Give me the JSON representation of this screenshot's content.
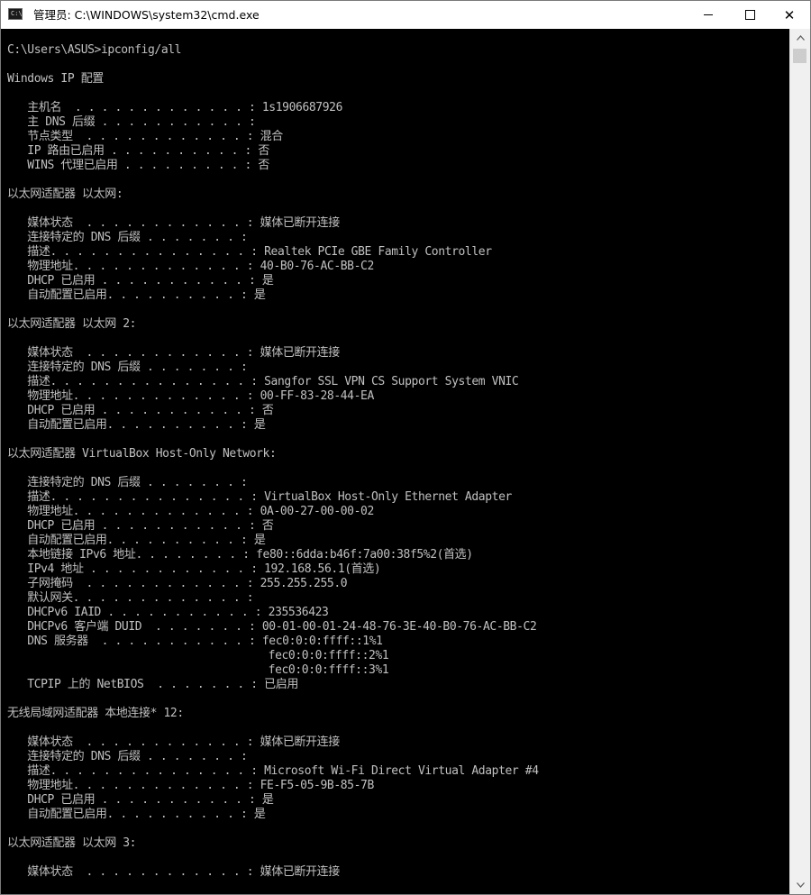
{
  "window": {
    "title": "管理员: C:\\WINDOWS\\system32\\cmd.exe",
    "icon": "cmd-icon",
    "icon_glyph": "C:\\"
  },
  "controls": {
    "minimize": "minimize-icon",
    "maximize": "maximize-icon",
    "close": "close-icon",
    "close_glyph": "✕"
  },
  "console": {
    "lines": [
      "C:\\Users\\ASUS>ipconfig/all",
      "",
      "Windows IP 配置",
      "",
      "   主机名  . . . . . . . . . . . . . : 1s1906687926",
      "   主 DNS 后缀 . . . . . . . . . . . :",
      "   节点类型  . . . . . . . . . . . . : 混合",
      "   IP 路由已启用 . . . . . . . . . . : 否",
      "   WINS 代理已启用 . . . . . . . . . : 否",
      "",
      "以太网适配器 以太网:",
      "",
      "   媒体状态  . . . . . . . . . . . . : 媒体已断开连接",
      "   连接特定的 DNS 后缀 . . . . . . . :",
      "   描述. . . . . . . . . . . . . . . : Realtek PCIe GBE Family Controller",
      "   物理地址. . . . . . . . . . . . . : 40-B0-76-AC-BB-C2",
      "   DHCP 已启用 . . . . . . . . . . . : 是",
      "   自动配置已启用. . . . . . . . . . : 是",
      "",
      "以太网适配器 以太网 2:",
      "",
      "   媒体状态  . . . . . . . . . . . . : 媒体已断开连接",
      "   连接特定的 DNS 后缀 . . . . . . . :",
      "   描述. . . . . . . . . . . . . . . : Sangfor SSL VPN CS Support System VNIC",
      "   物理地址. . . . . . . . . . . . . : 00-FF-83-28-44-EA",
      "   DHCP 已启用 . . . . . . . . . . . : 否",
      "   自动配置已启用. . . . . . . . . . : 是",
      "",
      "以太网适配器 VirtualBox Host-Only Network:",
      "",
      "   连接特定的 DNS 后缀 . . . . . . . :",
      "   描述. . . . . . . . . . . . . . . : VirtualBox Host-Only Ethernet Adapter",
      "   物理地址. . . . . . . . . . . . . : 0A-00-27-00-00-02",
      "   DHCP 已启用 . . . . . . . . . . . : 否",
      "   自动配置已启用. . . . . . . . . . : 是",
      "   本地链接 IPv6 地址. . . . . . . . : fe80::6dda:b46f:7a00:38f5%2(首选)",
      "   IPv4 地址 . . . . . . . . . . . . : 192.168.56.1(首选)",
      "   子网掩码  . . . . . . . . . . . . : 255.255.255.0",
      "   默认网关. . . . . . . . . . . . . :",
      "   DHCPv6 IAID . . . . . . . . . . . : 235536423",
      "   DHCPv6 客户端 DUID  . . . . . . . : 00-01-00-01-24-48-76-3E-40-B0-76-AC-BB-C2",
      "   DNS 服务器  . . . . . . . . . . . : fec0:0:0:ffff::1%1",
      "                                       fec0:0:0:ffff::2%1",
      "                                       fec0:0:0:ffff::3%1",
      "   TCPIP 上的 NetBIOS  . . . . . . . : 已启用",
      "",
      "无线局域网适配器 本地连接* 12:",
      "",
      "   媒体状态  . . . . . . . . . . . . : 媒体已断开连接",
      "   连接特定的 DNS 后缀 . . . . . . . :",
      "   描述. . . . . . . . . . . . . . . : Microsoft Wi-Fi Direct Virtual Adapter #4",
      "   物理地址. . . . . . . . . . . . . : FE-F5-05-9B-85-7B",
      "   DHCP 已启用 . . . . . . . . . . . : 是",
      "   自动配置已启用. . . . . . . . . . : 是",
      "",
      "以太网适配器 以太网 3:",
      "",
      "   媒体状态  . . . . . . . . . . . . : 媒体已断开连接"
    ]
  },
  "scrollbar": {
    "up_icon": "scroll-up-arrow-icon",
    "down_icon": "scroll-down-arrow-icon",
    "up_glyph": "▲",
    "down_glyph": "▼"
  },
  "colors": {
    "console_bg": "#000000",
    "console_fg": "#c0c0c0",
    "titlebar_bg": "#ffffff"
  }
}
